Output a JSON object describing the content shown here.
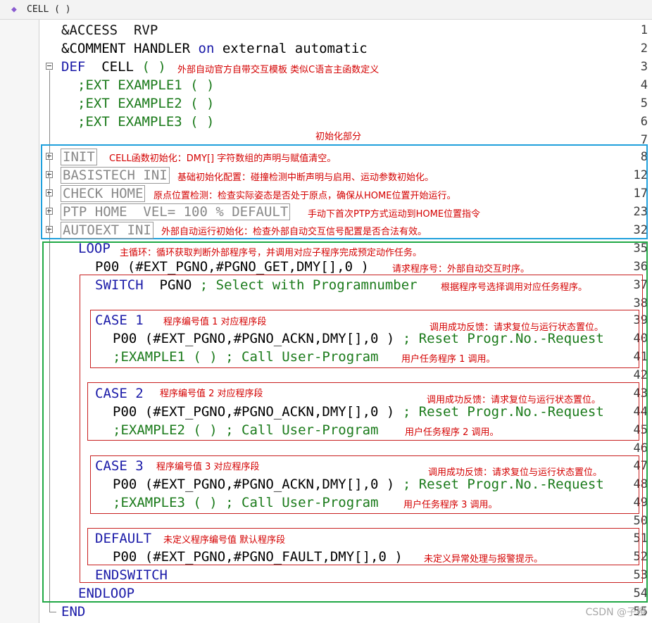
{
  "tab": {
    "title": "CELL ( )",
    "icon": "module-icon"
  },
  "line_numbers": [
    "1",
    "2",
    "3",
    "4",
    "5",
    "6",
    "7",
    "8",
    "12",
    "17",
    "23",
    "32",
    "35",
    "36",
    "37",
    "38",
    "39",
    "40",
    "41",
    "42",
    "43",
    "44",
    "45",
    "46",
    "47",
    "48",
    "49",
    "50",
    "51",
    "52",
    "53",
    "54",
    "55"
  ],
  "code": {
    "access_kw": "&ACCESS",
    "access_val": "RVP",
    "comment_kw": "&COMMENT",
    "comment_a": "HANDLER",
    "comment_on": "on",
    "comment_b": "external automatic",
    "def_kw": "DEF",
    "def_name": "CELL",
    "def_paren": "( )",
    "ext1": ";EXT EXAMPLE1 ( )",
    "ext2": ";EXT EXAMPLE2 ( )",
    "ext3": ";EXT EXAMPLE3 ( )",
    "fold_init": "INIT",
    "fold_basistech": "BASISTECH INI",
    "fold_check": "CHECK HOME",
    "fold_ptp": "PTP HOME  VEL= 100 % DEFAULT",
    "fold_autoext": "AUTOEXT INI",
    "loop_kw": "LOOP",
    "pgno_get": "P00 (#EXT_PGNO,#PGNO_GET,DMY[],0 )",
    "switch_kw": "SWITCH",
    "switch_var": "PGNO",
    "switch_comment": "; Select with Programnumber",
    "case_kw": "CASE",
    "case1_num": "1",
    "case2_num": "2",
    "case3_num": "3",
    "ackn_call": "P00 (#EXT_PGNO,#PGNO_ACKN,DMY[],0 )",
    "ackn_comment": "; Reset Progr.No.-Request",
    "call1": ";EXAMPLE1 ( ) ; Call User-Program",
    "call2": ";EXAMPLE2 ( ) ; Call User-Program",
    "call3": ";EXAMPLE3 ( ) ; Call User-Program",
    "default_kw": "DEFAULT",
    "fault_call": "P00 (#EXT_PGNO,#PGNO_FAULT,DMY[],0 )",
    "endswitch_kw": "ENDSWITCH",
    "endloop_kw": "ENDLOOP",
    "end_kw": "END"
  },
  "notes": {
    "def": "外部自动官方自带交互模板 类似C语言主函数定义",
    "init_section": "初始化部分",
    "init": "CELL函数初始化：DMY[] 字符数组的声明与赋值清空。",
    "basistech": "基础初始化配置：碰撞检测中断声明与启用、运动参数初始化。",
    "check": "原点位置检测：检查实际姿态是否处于原点，确保从HOME位置开始运行。",
    "ptp": "手动下首次PTP方式运动到HOME位置指令",
    "autoext": "外部自动运行初始化：检查外部自动交互信号配置是否合法有效。",
    "loop": "主循环：循环获取判断外部程序号，并调用对应子程序完成预定动作任务。",
    "pgno_get": "请求程序号：外部自动交互时序。",
    "switch": "根据程序号选择调用对应任务程序。",
    "case1": "程序编号值 1 对应程序段",
    "case2": "程序编号值 2 对应程序段",
    "case3": "程序编号值 3 对应程序段",
    "ackn": "调用成功反馈：请求复位与运行状态置位。",
    "call1": "用户任务程序 1 调用。",
    "call2": "用户任务程序 2 调用。",
    "call3": "用户任务程序 3 调用。",
    "default": "未定义程序编号值 默认程序段",
    "fault": "未定义异常处理与报警提示。"
  },
  "watermark": "CSDN @子橙",
  "colors": {
    "keyword": "#1a1aa8",
    "comment": "#1a7a1a",
    "note": "#d40000",
    "init_box": "#1fa0dc",
    "loop_box": "#20a845",
    "case_box": "#c82020"
  }
}
